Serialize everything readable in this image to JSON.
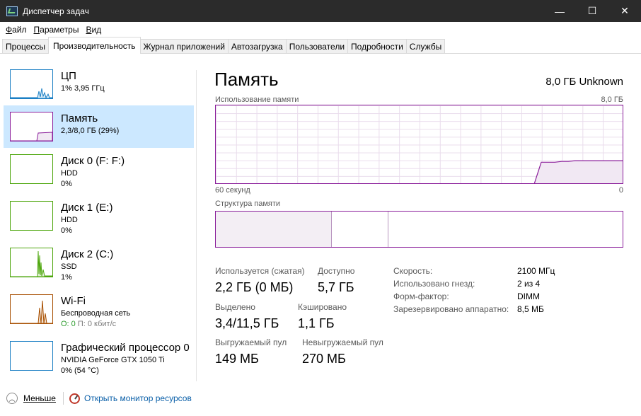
{
  "window": {
    "title": "Диспетчер задач",
    "minimize": "—",
    "maximize": "☐",
    "close": "✕"
  },
  "menu": [
    {
      "hotkey": "Ф",
      "rest": "айл"
    },
    {
      "hotkey": "П",
      "rest": "араметры"
    },
    {
      "hotkey": "В",
      "rest": "ид"
    }
  ],
  "tabs": [
    "Процессы",
    "Производительность",
    "Журнал приложений",
    "Автозагрузка",
    "Пользователи",
    "Подробности",
    "Службы"
  ],
  "active_tab": "Производительность",
  "sidebar": {
    "items": [
      {
        "name": "ЦП",
        "sub1": "1% 3,95 ГГц",
        "sub2": "",
        "color": "#1b7fc4"
      },
      {
        "name": "Память",
        "sub1": "2,3/8,0 ГБ (29%)",
        "sub2": "",
        "color": "#8b1f9b",
        "selected": true
      },
      {
        "name": "Диск 0 (F: F:)",
        "sub1": "HDD",
        "sub2": "0%",
        "color": "#4da60c"
      },
      {
        "name": "Диск 1 (E:)",
        "sub1": "HDD",
        "sub2": "0%",
        "color": "#4da60c"
      },
      {
        "name": "Диск 2 (C:)",
        "sub1": "SSD",
        "sub2": "1%",
        "color": "#4da60c"
      },
      {
        "name": "Wi-Fi",
        "sub1": "Беспроводная сеть",
        "sub2_o": "О: 0",
        "sub2_p": "П: 0 кбит/с",
        "color": "#a74f01"
      },
      {
        "name": "Графический процессор 0",
        "sub1": "NVIDIA GeForce GTX 1050 Ti",
        "sub2": "0% (54 °C)",
        "color": "#1b7fc4"
      }
    ]
  },
  "main": {
    "title": "Память",
    "total": "8,0 ГБ Unknown",
    "usage_label": "Использование памяти",
    "usage_max": "8,0 ГБ",
    "x_left": "60 секунд",
    "x_right": "0",
    "composition_label": "Структура памяти",
    "composition": {
      "in_use_fraction": 0.285,
      "modified_fraction": 0.14
    },
    "usage_series_fraction": [
      0,
      0,
      0,
      0,
      0,
      0,
      0,
      0,
      0,
      0,
      0,
      0,
      0,
      0,
      0,
      0,
      0,
      0,
      0,
      0,
      0,
      0,
      0,
      0,
      0,
      0,
      0,
      0,
      0,
      0,
      0,
      0,
      0,
      0,
      0,
      0,
      0,
      0,
      0,
      0,
      0,
      0,
      0,
      0,
      0,
      0,
      0,
      0,
      0.27,
      0.27,
      0.27,
      0.28,
      0.28,
      0.29,
      0.29,
      0.29,
      0.29,
      0.29,
      0.29,
      0.29,
      0.29
    ],
    "stats": {
      "in_use_label": "Используется (сжатая)",
      "in_use_value": "2,2 ГБ (0 МБ)",
      "available_label": "Доступно",
      "available_value": "5,7 ГБ",
      "committed_label": "Выделено",
      "committed_value": "3,4/11,5 ГБ",
      "cached_label": "Кэшировано",
      "cached_value": "1,1 ГБ",
      "paged_label": "Выгружаемый пул",
      "paged_value": "149 МБ",
      "nonpaged_label": "Невыгружаемый пул",
      "nonpaged_value": "270 МБ"
    },
    "details": [
      {
        "key": "Скорость:",
        "value": "2100 МГц"
      },
      {
        "key": "Использовано гнезд:",
        "value": "2 из 4"
      },
      {
        "key": "Форм-фактор:",
        "value": "DIMM"
      },
      {
        "key": "Зарезервировано аппаратно:",
        "value": "8,5 МБ"
      }
    ]
  },
  "footer": {
    "less": "Меньше",
    "resource_monitor": "Открыть монитор ресурсов"
  }
}
